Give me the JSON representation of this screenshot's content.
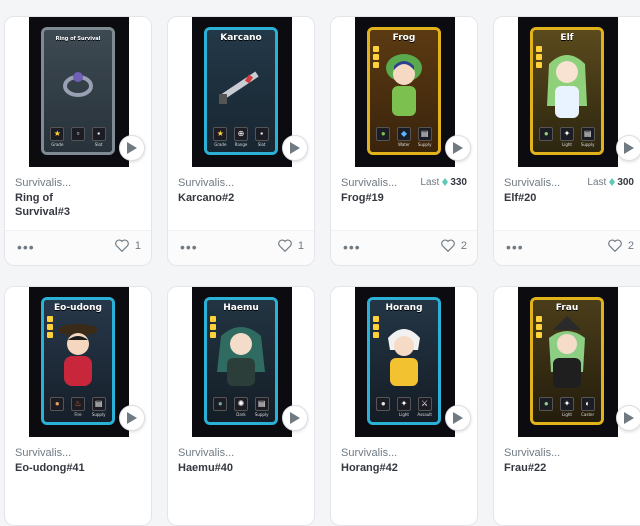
{
  "cards": [
    {
      "collection": "Survivalis...",
      "name": "Ring of Survival#3",
      "likes": "1",
      "frame_title": "Ring of Survival",
      "stats": [
        "Grade",
        "",
        "Slot"
      ],
      "stars": 0
    },
    {
      "collection": "Survivalis...",
      "name": "Karcano#2",
      "likes": "1",
      "frame_title": "Karcano",
      "stats": [
        "Grade",
        "Range",
        "Slot"
      ],
      "stars": 0
    },
    {
      "collection": "Survivalis...",
      "name": "Frog#19",
      "likes": "2",
      "last_label": "Last",
      "last_price": "330",
      "frame_title": "Frog",
      "stats": [
        "Water",
        "Supply"
      ],
      "stars": 3
    },
    {
      "collection": "Survivalis...",
      "name": "Elf#20",
      "likes": "2",
      "last_label": "Last",
      "last_price": "300",
      "frame_title": "Elf",
      "stats": [
        "Light",
        "Supply"
      ],
      "stars": 3
    },
    {
      "collection": "Survivalis...",
      "name": "Eo-udong#41",
      "likes": "",
      "frame_title": "Eo-udong",
      "stats": [
        "Fire",
        "Supply"
      ],
      "stars": 3
    },
    {
      "collection": "Survivalis...",
      "name": "Haemu#40",
      "likes": "",
      "frame_title": "Haemu",
      "stats": [
        "Dark",
        "Supply"
      ],
      "stars": 3
    },
    {
      "collection": "Survivalis...",
      "name": "Horang#42",
      "likes": "",
      "frame_title": "Horang",
      "stats": [
        "Light",
        "Assault"
      ],
      "stars": 3
    },
    {
      "collection": "Survivalis...",
      "name": "Frau#22",
      "likes": "",
      "frame_title": "Frau",
      "stats": [
        "Light",
        "Caster"
      ],
      "stars": 3
    }
  ],
  "colors": {
    "link_text": "#353840",
    "muted": "#707a83",
    "eth": "#5fc9b8"
  },
  "icons": [
    "play-icon",
    "more-icon",
    "heart-icon",
    "eth-icon"
  ]
}
